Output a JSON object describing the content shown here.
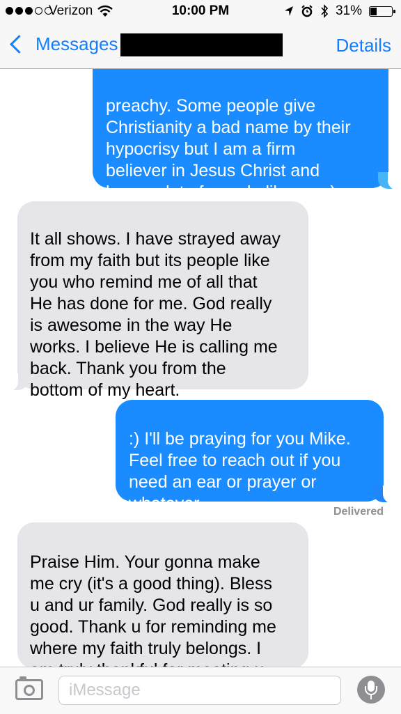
{
  "status_bar": {
    "carrier": "Verizon",
    "time": "10:00 PM",
    "battery_text": "31%",
    "battery_level": 0.31,
    "signal_bars_filled": 3,
    "signal_bars_total": 5,
    "icons": [
      "wifi-icon",
      "location-arrow-icon",
      "alarm-icon",
      "bluetooth-icon",
      "battery-icon"
    ]
  },
  "nav": {
    "back_label": "Messages",
    "details_label": "Details"
  },
  "messages": [
    {
      "direction": "outgoing",
      "text": "preachy. Some people give\nChristianity a bad name by their\nhypocrisy but I am a firm\nbeliever in Jesus Christ and\nknow a lot of people like me :)"
    },
    {
      "direction": "incoming",
      "text": "It all shows. I have strayed away\nfrom my faith but its people like\nyou who remind me of all that\nHe has done for me. God really\nis awesome in the way He\nworks. I believe He is calling me\nback. Thank you from the\nbottom of my heart."
    },
    {
      "direction": "outgoing",
      "text": ":) I'll be praying for you Mike.\nFeel free to reach out if you\nneed an ear or prayer or\nwhatever"
    },
    {
      "direction": "incoming",
      "text": "Praise Him. Your gonna make\nme cry (it's a good thing). Bless\nu and ur family. God really is so\ngood. Thank u for reminding me\nwhere my faith truly belongs. I\nam truly thankful for meeting u."
    }
  ],
  "delivered_label": "Delivered",
  "input": {
    "placeholder": "iMessage"
  },
  "colors": {
    "accent": "#157efb",
    "outgoing_bubble": "#1a8cff",
    "incoming_bubble": "#e5e5ea"
  }
}
